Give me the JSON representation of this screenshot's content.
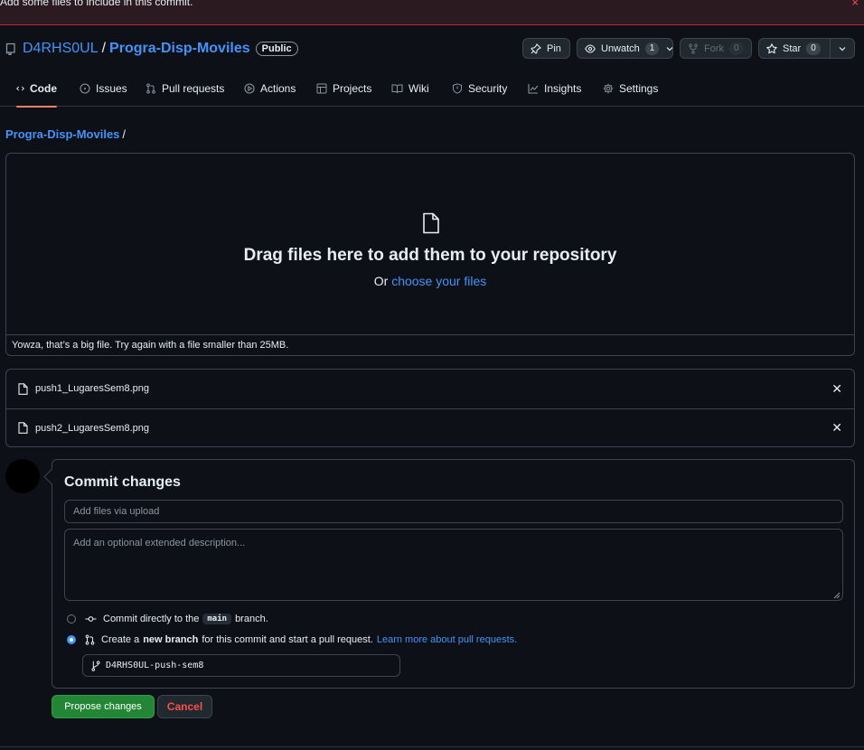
{
  "banner": {
    "text": "Add some files to include in this commit.",
    "close_glyph": "×"
  },
  "repo": {
    "owner": "D4RHS0UL",
    "separator": "/",
    "name": "Progra-Disp-Moviles",
    "visibility": "Public"
  },
  "actions": {
    "pin": "Pin",
    "unwatch": "Unwatch",
    "watch_count": "1",
    "fork": "Fork",
    "fork_count": "0",
    "star": "Star",
    "star_count": "0"
  },
  "tabs": [
    {
      "label": "Code",
      "icon": "code-icon",
      "active": true
    },
    {
      "label": "Issues",
      "icon": "issue-icon"
    },
    {
      "label": "Pull requests",
      "icon": "pull-request-icon"
    },
    {
      "label": "Actions",
      "icon": "play-icon"
    },
    {
      "label": "Projects",
      "icon": "table-icon"
    },
    {
      "label": "Wiki",
      "icon": "book-icon"
    },
    {
      "label": "Security",
      "icon": "shield-icon"
    },
    {
      "label": "Insights",
      "icon": "graph-icon"
    },
    {
      "label": "Settings",
      "icon": "gear-icon"
    }
  ],
  "breadcrumb": {
    "repo": "Progra-Disp-Moviles",
    "sep": "/"
  },
  "dropzone": {
    "title": "Drag files here to add them to your repository",
    "or": "Or",
    "choose": "choose your files",
    "error": "Yowza, that’s a big file. Try again with a file smaller than 25MB."
  },
  "files": [
    {
      "name": "push1_LugaresSem8.png"
    },
    {
      "name": "push2_LugaresSem8.png"
    }
  ],
  "commit": {
    "title": "Commit changes",
    "summary_placeholder": "Add files via upload",
    "description_placeholder": "Add an optional extended description...",
    "direct_prefix": "Commit directly to the",
    "direct_branch": "main",
    "direct_suffix": "branch.",
    "new_prefix": "Create a",
    "new_bold": "new branch",
    "new_suffix": "for this commit and start a pull request.",
    "learn_more": "Learn more about pull requests.",
    "branch_name": "D4RHS0UL-push-sem8",
    "selected_option": "new-branch"
  },
  "buttons": {
    "propose": "Propose changes",
    "cancel": "Cancel"
  },
  "colors": {
    "background": "#0d1117",
    "link": "#4493f8",
    "primary_button": "#238636",
    "danger": "#f85149",
    "active_tab_underline": "#f78166"
  }
}
